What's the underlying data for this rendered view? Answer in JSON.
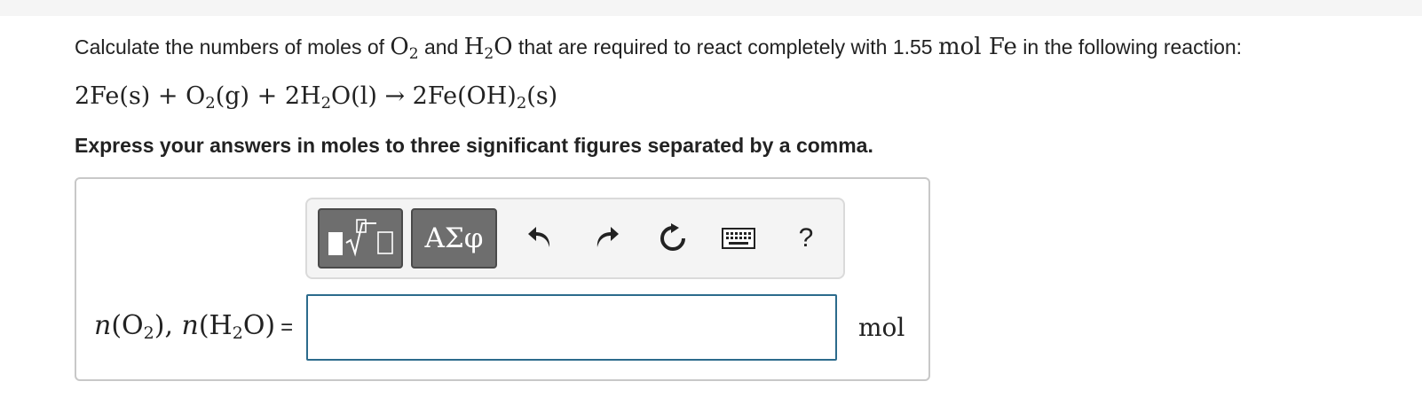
{
  "question": {
    "pre": "Calculate the numbers of moles of ",
    "o2": "O",
    "o2_sub": "2",
    "and": " and ",
    "h2o_h": "H",
    "h2o_sub": "2",
    "h2o_o": "O",
    "mid": " that are required to react completely with 1.55 ",
    "unit_mol": "mol",
    "fe": " Fe",
    "post": " in the following reaction:"
  },
  "equation": {
    "p1": "2Fe(s) + O",
    "s1": "2",
    "p2": "(g) + 2H",
    "s2": "2",
    "p3": "O(l) → 2Fe(OH)",
    "s3": "2",
    "p4": "(s)"
  },
  "instruction": "Express your answers in moles to three significant figures separated by a comma.",
  "toolbar": {
    "greek_label": "ΑΣφ",
    "help_label": "?"
  },
  "answer": {
    "label_n1": "n",
    "label_p1": "(O",
    "label_s1": "2",
    "label_p2": "), ",
    "label_n2": "n",
    "label_p3": "(H",
    "label_s2": "2",
    "label_p4": "O)",
    "label_eq": "=",
    "value": "",
    "unit": "mol"
  }
}
